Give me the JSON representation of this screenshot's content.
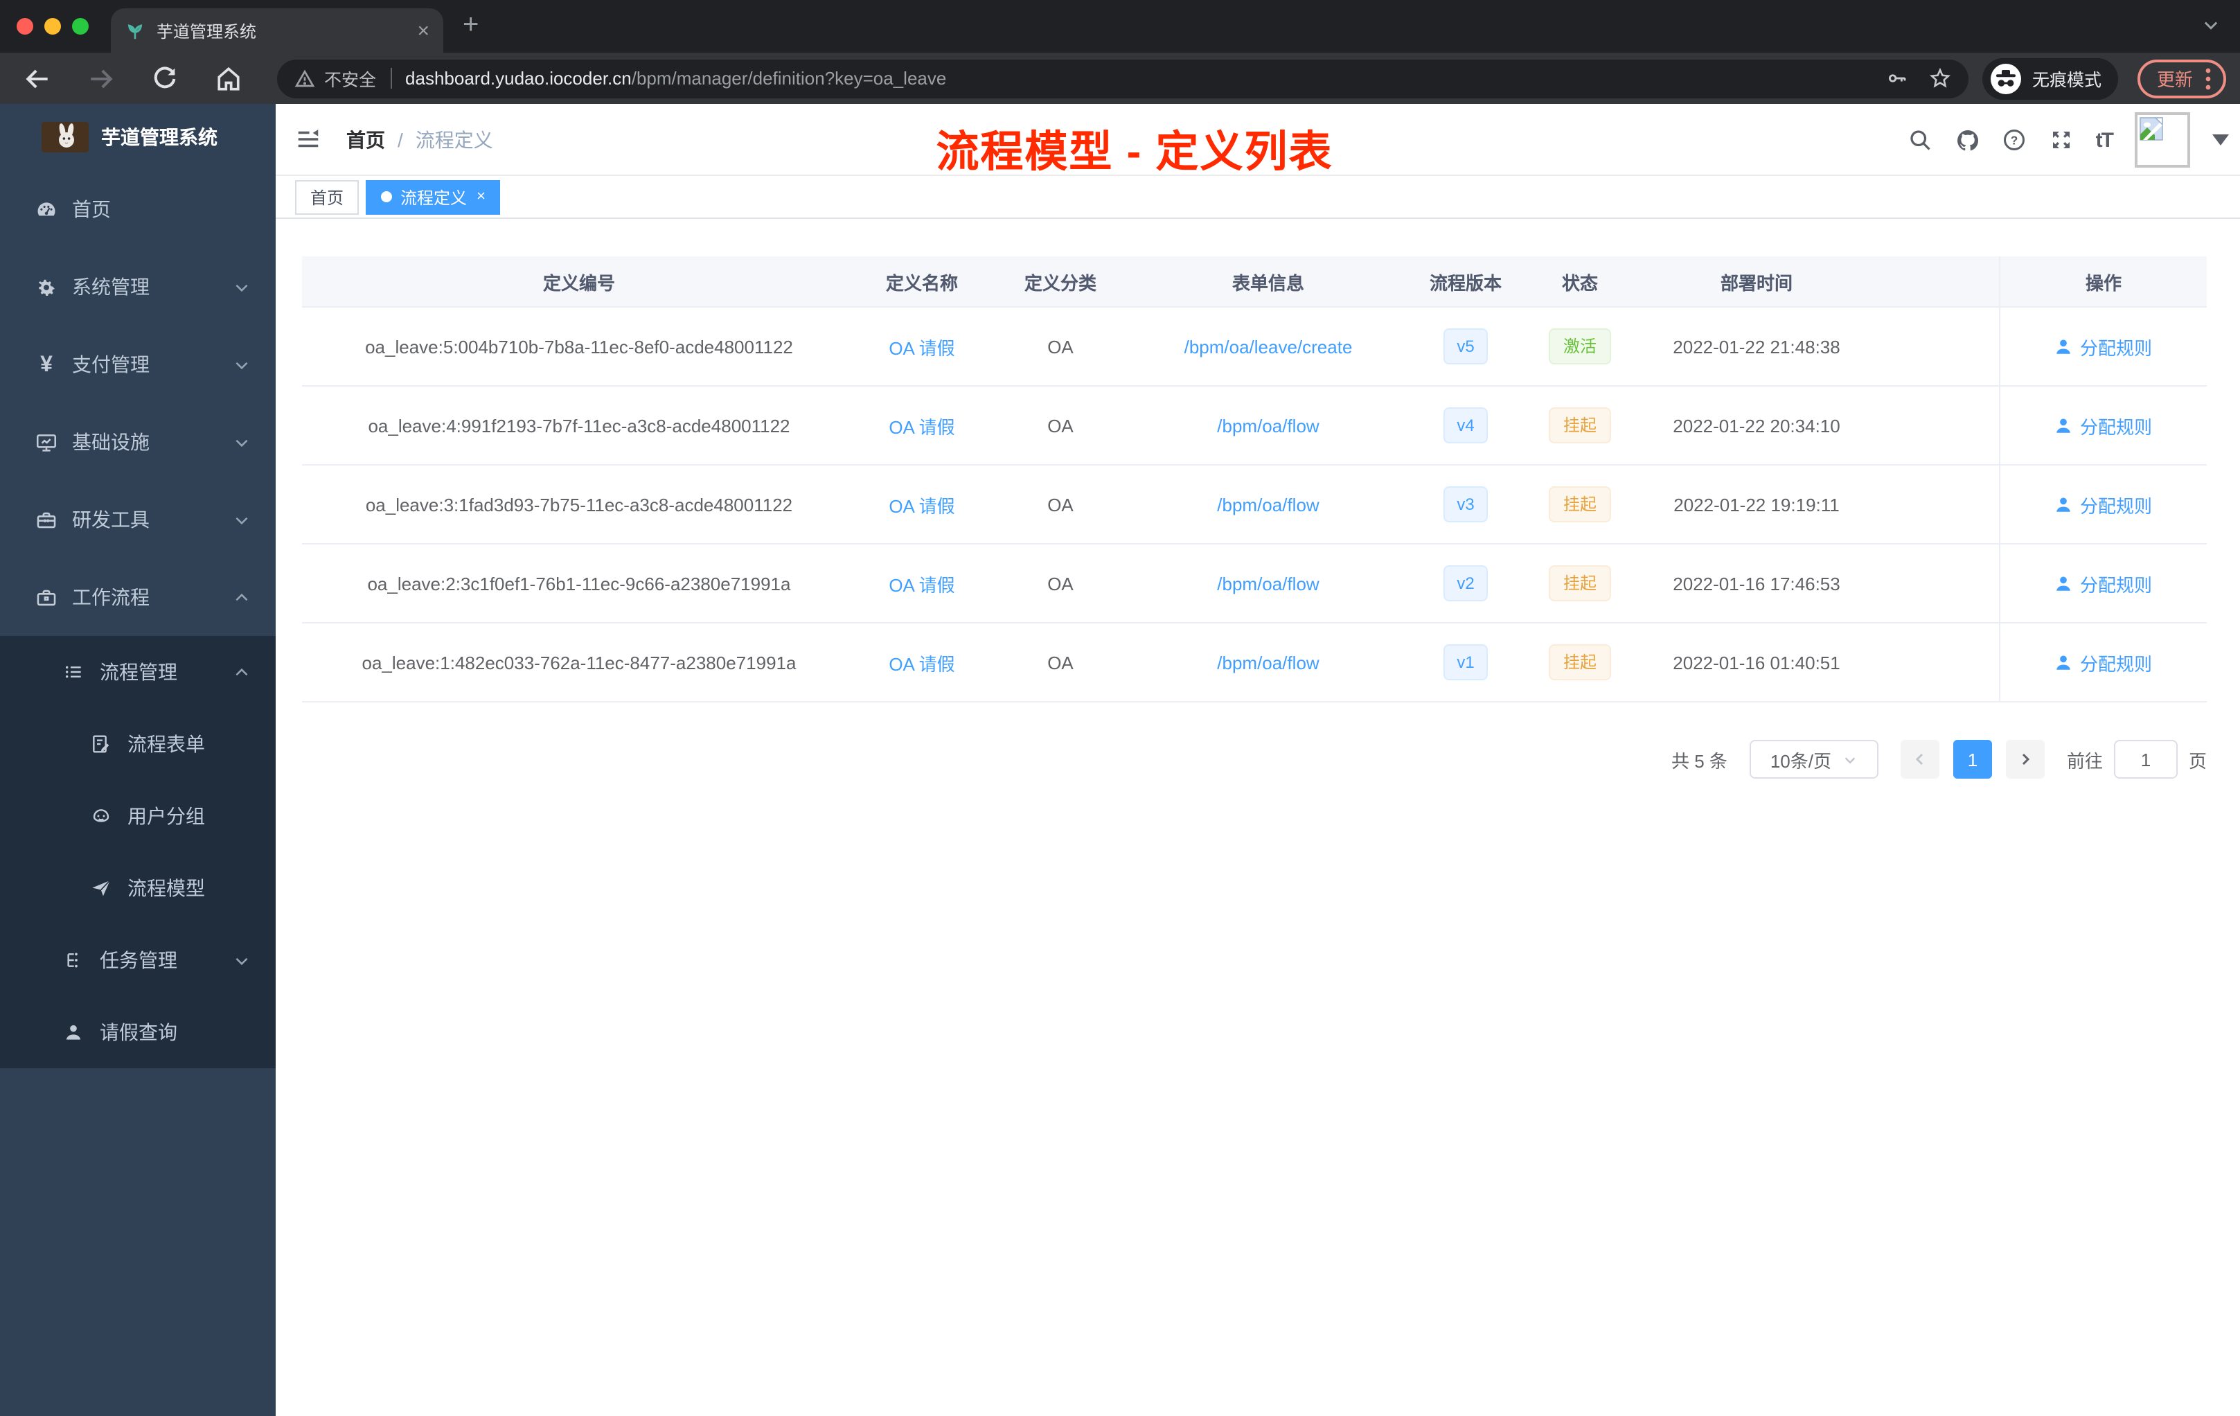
{
  "browser": {
    "tab_title": "芋道管理系统",
    "new_tab": "+",
    "tab_close": "×",
    "security_label": "不安全",
    "url_host": "dashboard.yudao.iocoder.cn",
    "url_path": "/bpm/manager/definition?key=oa_leave",
    "incognito_label": "无痕模式",
    "update_label": "更新"
  },
  "sidebar": {
    "logo_title": "芋道管理系统",
    "items": [
      {
        "label": "首页",
        "icon": "dashboard-icon"
      },
      {
        "label": "系统管理",
        "icon": "gear-icon"
      },
      {
        "label": "支付管理",
        "icon": "yen-icon"
      },
      {
        "label": "基础设施",
        "icon": "monitor-icon"
      },
      {
        "label": "研发工具",
        "icon": "toolbox-icon"
      },
      {
        "label": "工作流程",
        "icon": "briefcase-icon"
      }
    ],
    "submenu": [
      {
        "label": "流程管理",
        "icon": "list-icon"
      },
      {
        "label": "流程表单",
        "icon": "form-icon"
      },
      {
        "label": "用户分组",
        "icon": "robot-icon"
      },
      {
        "label": "流程模型",
        "icon": "paper-plane-icon"
      },
      {
        "label": "任务管理",
        "icon": "tree-icon"
      },
      {
        "label": "请假查询",
        "icon": "user-icon"
      }
    ],
    "yen_glyph": "¥"
  },
  "header": {
    "breadcrumb_home": "首页",
    "breadcrumb_separator": "/",
    "breadcrumb_current": "流程定义",
    "annotation": "流程模型 - 定义列表",
    "font_size_icon_label": "tT"
  },
  "tags": {
    "home": "首页",
    "active": "流程定义",
    "close": "×"
  },
  "table": {
    "columns": [
      "定义编号",
      "定义名称",
      "定义分类",
      "表单信息",
      "流程版本",
      "状态",
      "部署时间",
      "操作"
    ],
    "action_label": "分配规则",
    "rows": [
      {
        "id": "oa_leave:5:004b710b-7b8a-11ec-8ef0-acde48001122",
        "name": "OA 请假",
        "category": "OA",
        "form": "/bpm/oa/leave/create",
        "version": "v5",
        "status": "激活",
        "status_type": "success",
        "deploy_time": "2022-01-22 21:48:38"
      },
      {
        "id": "oa_leave:4:991f2193-7b7f-11ec-a3c8-acde48001122",
        "name": "OA 请假",
        "category": "OA",
        "form": "/bpm/oa/flow",
        "version": "v4",
        "status": "挂起",
        "status_type": "warning",
        "deploy_time": "2022-01-22 20:34:10"
      },
      {
        "id": "oa_leave:3:1fad3d93-7b75-11ec-a3c8-acde48001122",
        "name": "OA 请假",
        "category": "OA",
        "form": "/bpm/oa/flow",
        "version": "v3",
        "status": "挂起",
        "status_type": "warning",
        "deploy_time": "2022-01-22 19:19:11"
      },
      {
        "id": "oa_leave:2:3c1f0ef1-76b1-11ec-9c66-a2380e71991a",
        "name": "OA 请假",
        "category": "OA",
        "form": "/bpm/oa/flow",
        "version": "v2",
        "status": "挂起",
        "status_type": "warning",
        "deploy_time": "2022-01-16 17:46:53"
      },
      {
        "id": "oa_leave:1:482ec033-762a-11ec-8477-a2380e71991a",
        "name": "OA 请假",
        "category": "OA",
        "form": "/bpm/oa/flow",
        "version": "v1",
        "status": "挂起",
        "status_type": "warning",
        "deploy_time": "2022-01-16 01:40:51"
      }
    ]
  },
  "pagination": {
    "total": "共 5 条",
    "page_size": "10条/页",
    "current_page": "1",
    "goto_label": "前往",
    "goto_value": "1",
    "page_unit": "页"
  },
  "colors": {
    "accent_blue": "#409eff",
    "annotation_red": "#ff2a00",
    "status_active_green": "#67c23a",
    "status_suspended_orange": "#e6a23c",
    "sidebar_bg": "#304156",
    "submenu_bg": "#1f2d3d"
  }
}
